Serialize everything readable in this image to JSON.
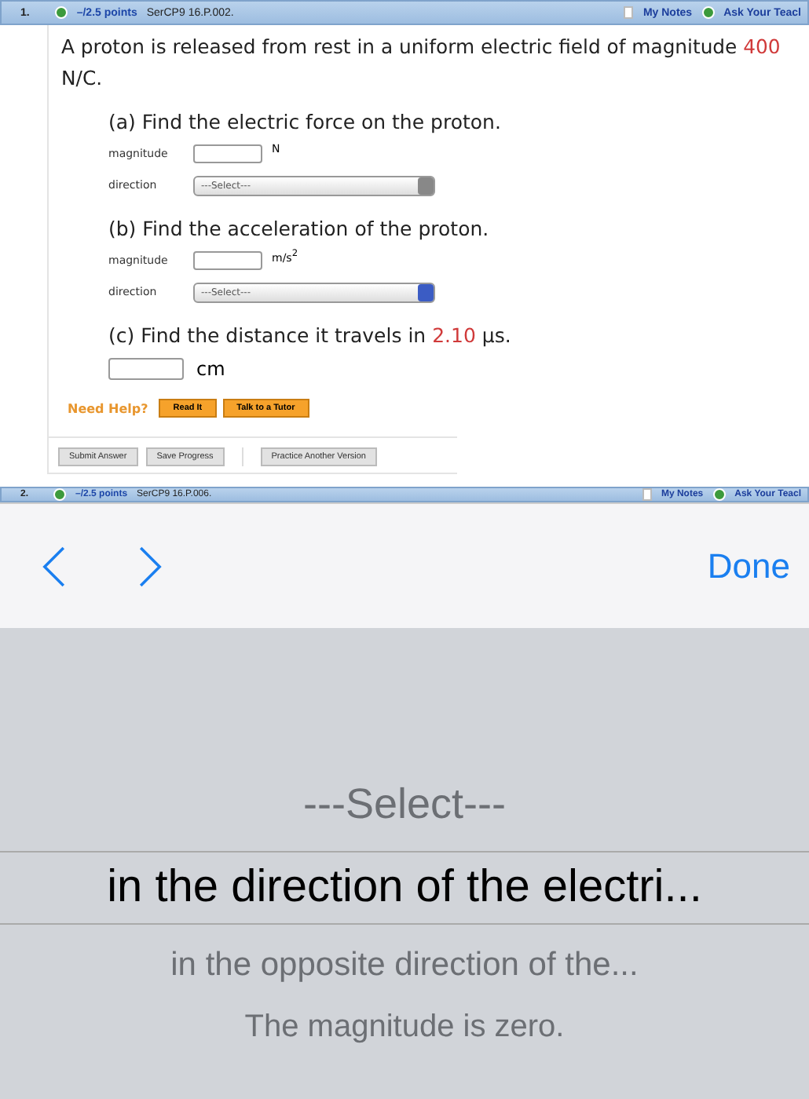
{
  "question_header": {
    "number": "1.",
    "points": "–/2.5 points",
    "code": "SerCP9 16.P.002.",
    "my_notes": "My Notes",
    "ask": "Ask Your Teacl"
  },
  "problem": {
    "text": "A proton is released from rest in a uniform electric field of magnitude ",
    "value": "400",
    "unit": "N/C."
  },
  "parts": [
    {
      "kind": "vector",
      "prompt": "(a) Find the electric force on the proton.",
      "magnitude_label": "magnitude",
      "unit": "N",
      "direction_label": "direction",
      "select": "---Select---",
      "focused": false
    },
    {
      "kind": "vector",
      "prompt": "(b) Find the acceleration of the proton.",
      "magnitude_label": "magnitude",
      "unit": "m/s$^{2}$",
      "direction_label": "direction",
      "select": "---Select---",
      "focused": true
    },
    {
      "kind": "scalar",
      "prompt_before": "(c) Find the distance it travels in ",
      "value": "2.10",
      "prompt_after": " µs.",
      "unit": "cm"
    }
  ],
  "help": {
    "label": "Need Help?",
    "buttons": [
      "Read It",
      "Talk to a Tutor"
    ]
  },
  "actions": [
    "Submit Answer",
    "Save Progress",
    "Practice Another Version"
  ],
  "next_header": {
    "number": "2.",
    "points": "–/2.5 points",
    "code": "SerCP9 16.P.006.",
    "my_notes": "My Notes",
    "ask": "Ask Your Teacl"
  },
  "picker_toolbar": {
    "done": "Done"
  },
  "picker_options": [
    {
      "label": "---Select---",
      "selected": false
    },
    {
      "label": "in the direction of the electri...",
      "selected": true
    },
    {
      "label": "in the opposite direction of the...",
      "selected": false
    },
    {
      "label": "The magnitude is zero.",
      "selected": false
    }
  ]
}
